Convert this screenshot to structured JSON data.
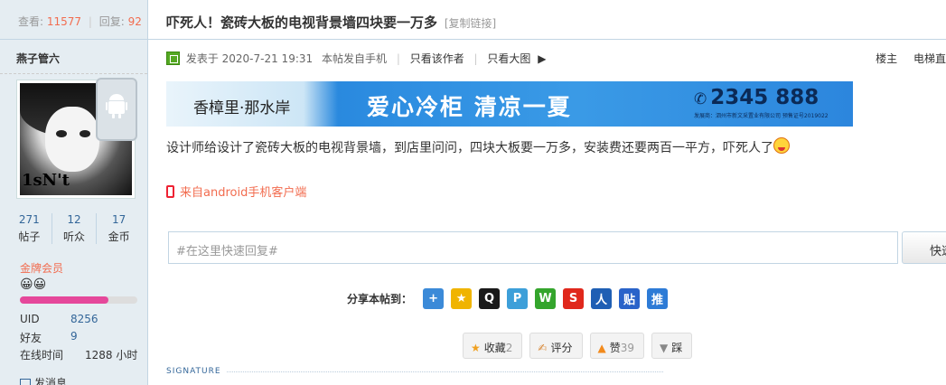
{
  "thread_stats": {
    "views_label": "查看:",
    "views": "11577",
    "replies_label": "回复:",
    "replies": "92"
  },
  "author": {
    "name": "燕子管六",
    "avatar_text": "1sN't",
    "counts": [
      {
        "value": "271",
        "label": "帖子"
      },
      {
        "value": "12",
        "label": "听众"
      },
      {
        "value": "17",
        "label": "金币"
      }
    ],
    "rank": "金牌会员",
    "rank_progress": 0.75,
    "meta": [
      {
        "key": "UID",
        "value": "8256"
      },
      {
        "key": "好友",
        "value": "9"
      },
      {
        "key": "在线时间",
        "value": "1288 小时"
      }
    ],
    "send_message": "发消息"
  },
  "thread": {
    "title": "吓死人！瓷砖大板的电视背景墙四块要一万多",
    "copy_link": "[复制链接]"
  },
  "post_meta": {
    "posted": "发表于 2020-7-21 19:31",
    "device": "本帖发自手机",
    "only_author": "只看该作者",
    "only_big_image": "只看大图",
    "floor": "楼主",
    "floor_extra": "电梯直"
  },
  "banner": {
    "brand": "香樟里·那水岸",
    "slogan": "爱心冷柜 清凉一夏",
    "phone": "2345 888",
    "sub": "发展商：泗州市新文采置业有限公司  预售证号2019022"
  },
  "post": {
    "body": "设计师给设计了瓷砖大板的电视背景墙，到店里问问，四块大板要一万多，安装费还要两百一平方，吓死人了"
  },
  "from_mobile": "来自android手机客户端",
  "quick_reply": {
    "placeholder": "#在这里快速回复#",
    "button": "快速"
  },
  "share": {
    "label": "分享本帖到：",
    "icons": [
      {
        "name": "share-more-icon",
        "glyph": "+",
        "color": "#3b8ad8"
      },
      {
        "name": "qzone-icon",
        "glyph": "★",
        "color": "#f0b400"
      },
      {
        "name": "qq-icon",
        "glyph": "Q",
        "color": "#1a1a1a"
      },
      {
        "name": "tencent-weibo-icon",
        "glyph": "P",
        "color": "#3d9fd9"
      },
      {
        "name": "wechat-icon",
        "glyph": "W",
        "color": "#34a52c"
      },
      {
        "name": "sina-weibo-icon",
        "glyph": "S",
        "color": "#e0281c"
      },
      {
        "name": "renren-icon",
        "glyph": "人",
        "color": "#1f5fb4"
      },
      {
        "name": "tieba-icon",
        "glyph": "贴",
        "color": "#2a63c9"
      },
      {
        "name": "huaban-icon",
        "glyph": "推",
        "color": "#2d7bd6"
      }
    ]
  },
  "actions": [
    {
      "name": "favorite-button",
      "icon": "star-icon",
      "glyph": "★",
      "color": "#f0a020",
      "label": "收藏",
      "count": "2"
    },
    {
      "name": "rate-button",
      "icon": "thumb-icon",
      "glyph": "✍",
      "color": "#d88a3a",
      "label": "评分",
      "count": ""
    },
    {
      "name": "like-button",
      "icon": "up-arrow-icon",
      "glyph": "▲",
      "color": "#f28a1c",
      "label": "赞",
      "count": "39"
    },
    {
      "name": "dislike-button",
      "icon": "down-arrow-icon",
      "glyph": "▼",
      "color": "#888888",
      "label": "踩",
      "count": ""
    }
  ],
  "signature_label": "SIGNATURE"
}
